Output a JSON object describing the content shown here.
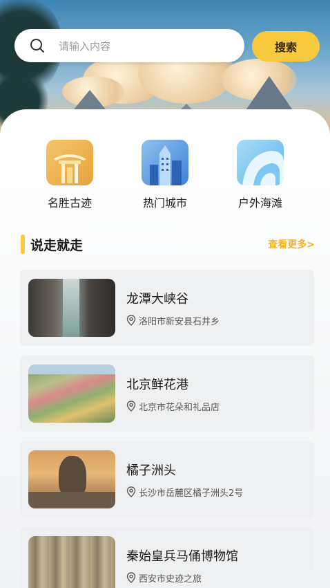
{
  "search": {
    "placeholder": "请输入内容",
    "button_label": "搜索"
  },
  "categories": [
    {
      "label": "名胜古迹",
      "icon": "pavilion-icon"
    },
    {
      "label": "热门城市",
      "icon": "city-buildings-icon"
    },
    {
      "label": "户外海滩",
      "icon": "beach-wave-icon"
    }
  ],
  "section": {
    "title": "说走就走",
    "more": "查看更多>"
  },
  "places": [
    {
      "name": "龙潭大峡谷",
      "location": "洛阳市新安县石井乡"
    },
    {
      "name": "北京鲜花港",
      "location": "北京市花朵和礼品店"
    },
    {
      "name": "橘子洲头",
      "location": "长沙市岳麓区橘子洲头2号"
    },
    {
      "name": "秦始皇兵马俑博物馆",
      "location": "西安市史迹之旅"
    }
  ],
  "colors": {
    "accent": "#f8c93e",
    "more_text": "#f0b42a"
  }
}
